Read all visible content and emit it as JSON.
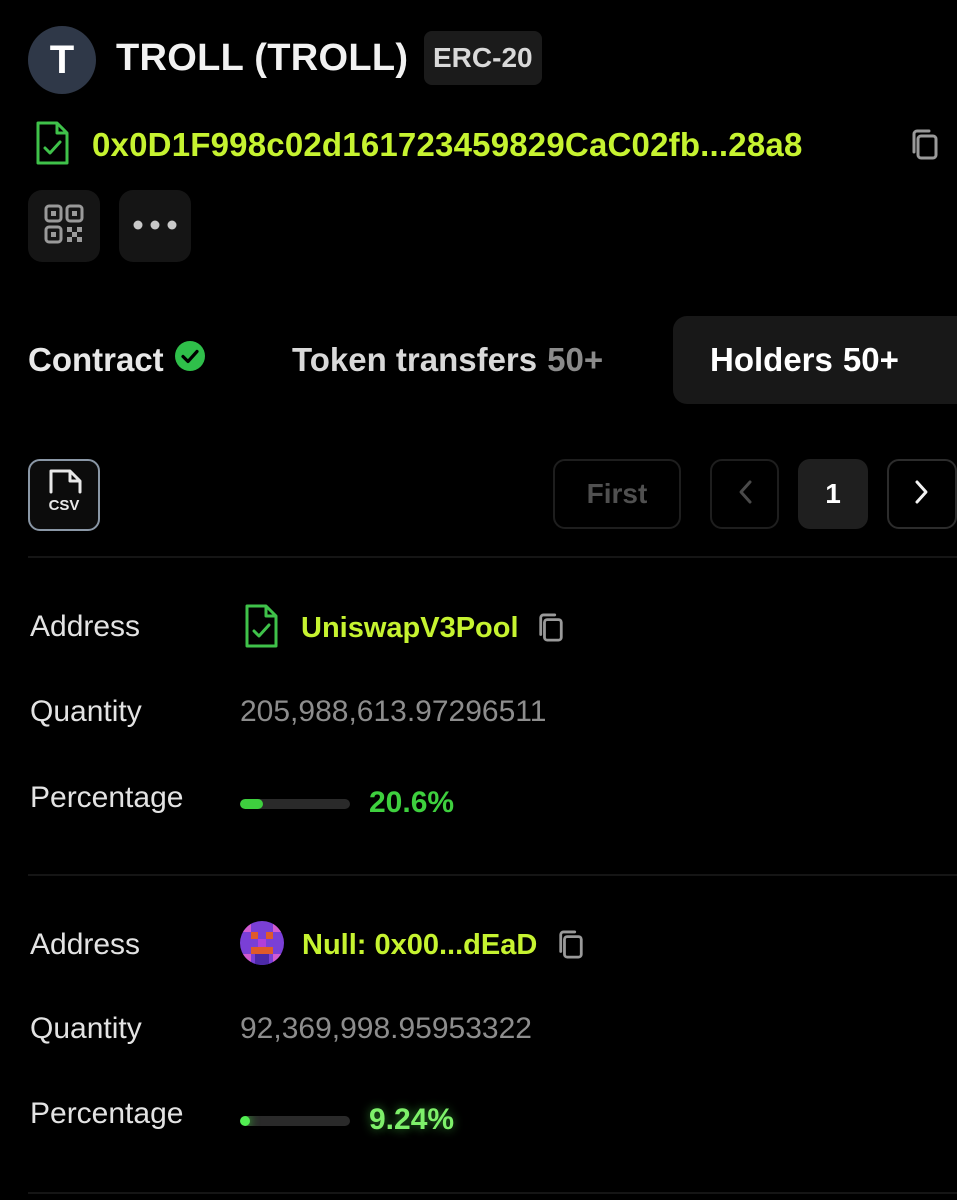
{
  "token": {
    "avatar_letter": "T",
    "title": "TROLL (TROLL)",
    "standard": "ERC-20",
    "address": "0x0D1F998c02d161723459829CaC02fb...28a8"
  },
  "tabs": [
    {
      "label": "Contract",
      "count": "",
      "verified": true
    },
    {
      "label": "Token transfers",
      "count": "50+"
    },
    {
      "label": "Holders",
      "count": "50+",
      "active": true
    }
  ],
  "toolbar": {
    "csv_label": "CSV",
    "first_label": "First",
    "current_page": "1"
  },
  "labels": {
    "address": "Address",
    "quantity": "Quantity",
    "percentage": "Percentage"
  },
  "holders": [
    {
      "name": "UniswapV3Pool",
      "icon": "contract-icon",
      "quantity": "205,988,613.97296511",
      "percentage": "20.6%",
      "percent_value": 20.6
    },
    {
      "name": "Null: 0x00...dEaD",
      "icon": "null-address-avatar",
      "quantity": "92,369,998.95953322",
      "percentage": "9.24%",
      "percent_value": 9.24
    }
  ],
  "colors": {
    "accent": "#c6f330",
    "success": "#3ecf3e",
    "background": "#000000"
  }
}
